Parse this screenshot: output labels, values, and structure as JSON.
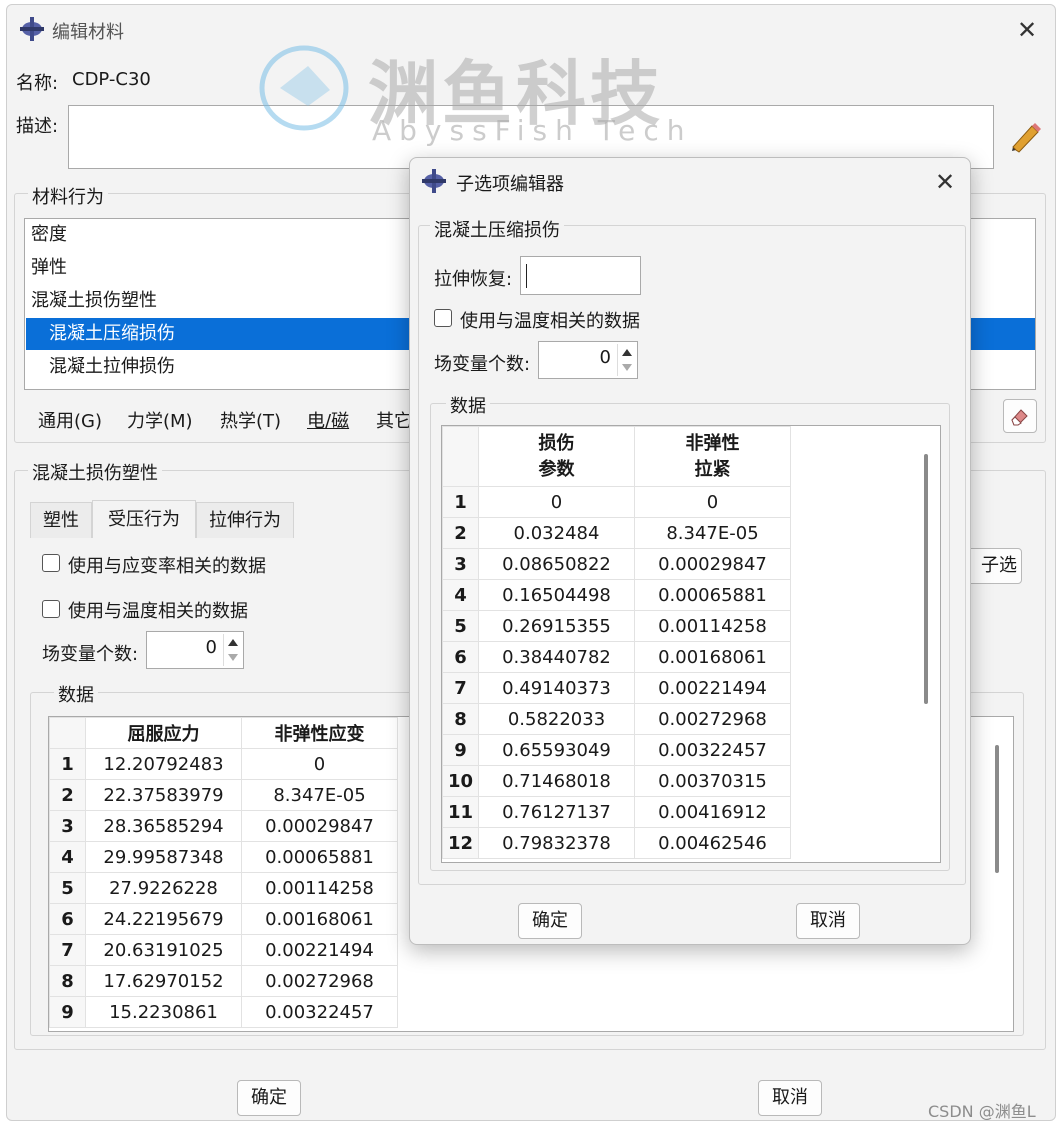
{
  "main_dialog": {
    "title": "编辑材料",
    "name_label": "名称:",
    "name_value": "CDP-C30",
    "description_label": "描述:",
    "description_value": "",
    "behavior_section_title": "材料行为",
    "behaviors": [
      {
        "label": "密度",
        "indent": false,
        "selected": false
      },
      {
        "label": "弹性",
        "indent": false,
        "selected": false
      },
      {
        "label": "混凝土损伤塑性",
        "indent": false,
        "selected": false
      },
      {
        "label": "混凝土压缩损伤",
        "indent": true,
        "selected": true
      },
      {
        "label": "混凝土拉伸损伤",
        "indent": true,
        "selected": false
      }
    ],
    "menu_tabs": [
      "通用(G)",
      "力学(M)",
      "热学(T)",
      "电/磁",
      "其它"
    ],
    "cdp_section_title": "混凝土损伤塑性",
    "subtabs": [
      "塑性",
      "受压行为",
      "拉伸行为"
    ],
    "active_subtab": "受压行为",
    "checkbox_rate": "使用与应变率相关的数据",
    "checkbox_temp": "使用与温度相关的数据",
    "field_vars_label": "场变量个数:",
    "field_vars_value": "0",
    "suboptions_button": "子选项",
    "data_section_title": "数据",
    "table": {
      "headers": [
        "屈服应力",
        "非弹性应变"
      ],
      "rows": [
        [
          "1",
          "12.20792483",
          "0"
        ],
        [
          "2",
          "22.37583979",
          "8.347E-05"
        ],
        [
          "3",
          "28.36585294",
          "0.00029847"
        ],
        [
          "4",
          "29.99587348",
          "0.00065881"
        ],
        [
          "5",
          "27.9226228",
          "0.00114258"
        ],
        [
          "6",
          "24.22195679",
          "0.00168061"
        ],
        [
          "7",
          "20.63191025",
          "0.00221494"
        ],
        [
          "8",
          "17.62970152",
          "0.00272968"
        ],
        [
          "9",
          "15.2230861",
          "0.00322457"
        ]
      ]
    },
    "ok_button": "确定",
    "cancel_button": "取消"
  },
  "sub_dialog": {
    "title": "子选项编辑器",
    "section_title": "混凝土压缩损伤",
    "tension_recovery_label": "拉伸恢复:",
    "tension_recovery_value": "",
    "checkbox_temp": "使用与温度相关的数据",
    "field_vars_label": "场变量个数:",
    "field_vars_value": "0",
    "data_section_title": "数据",
    "table": {
      "headers": [
        [
          "损伤",
          "参数"
        ],
        [
          "非弹性",
          "拉紧"
        ]
      ],
      "rows": [
        [
          "1",
          "0",
          "0"
        ],
        [
          "2",
          "0.032484",
          "8.347E-05"
        ],
        [
          "3",
          "0.08650822",
          "0.00029847"
        ],
        [
          "4",
          "0.16504498",
          "0.00065881"
        ],
        [
          "5",
          "0.26915355",
          "0.00114258"
        ],
        [
          "6",
          "0.38440782",
          "0.00168061"
        ],
        [
          "7",
          "0.49140373",
          "0.00221494"
        ],
        [
          "8",
          "0.5822033",
          "0.00272968"
        ],
        [
          "9",
          "0.65593049",
          "0.00322457"
        ],
        [
          "10",
          "0.71468018",
          "0.00370315"
        ],
        [
          "11",
          "0.76127137",
          "0.00416912"
        ],
        [
          "12",
          "0.79832378",
          "0.00462546"
        ]
      ]
    },
    "ok_button": "确定",
    "cancel_button": "取消"
  },
  "watermark": {
    "title": "渊鱼科技",
    "subtitle": "AbyssFish Tech",
    "credit": "CSDN @渊鱼L"
  },
  "colors": {
    "selection": "#0a6fd8",
    "dialog_bg": "#f3f3f3",
    "pencil": "#e0a030"
  },
  "icons": [
    "app-logo-icon",
    "close-icon",
    "pencil-icon",
    "eraser-icon",
    "chevron-up-icon",
    "chevron-down-icon"
  ]
}
